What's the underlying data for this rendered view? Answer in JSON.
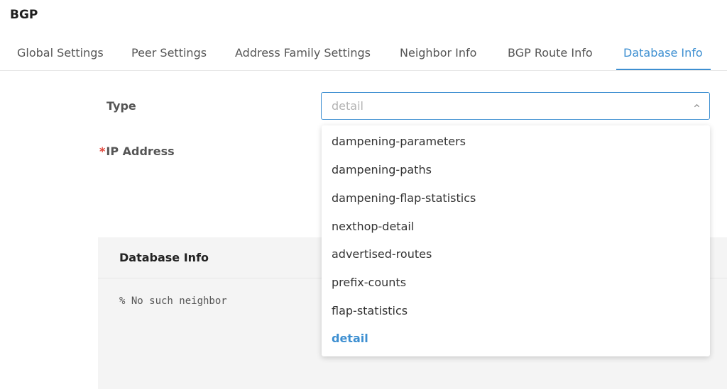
{
  "page": {
    "title": "BGP"
  },
  "tabs": [
    {
      "label": "Global Settings"
    },
    {
      "label": "Peer Settings"
    },
    {
      "label": "Address Family Settings"
    },
    {
      "label": "Neighbor Info"
    },
    {
      "label": "BGP Route Info"
    },
    {
      "label": "Database Info",
      "active": true
    }
  ],
  "form": {
    "type_label": "Type",
    "type_value": "detail",
    "ip_required_mark": "*",
    "ip_label": "IP Address"
  },
  "dropdown": {
    "options": [
      {
        "label": "dampening-parameters"
      },
      {
        "label": "dampening-paths"
      },
      {
        "label": "dampening-flap-statistics"
      },
      {
        "label": "nexthop-detail"
      },
      {
        "label": "advertised-routes"
      },
      {
        "label": "prefix-counts"
      },
      {
        "label": "flap-statistics"
      },
      {
        "label": "detail",
        "selected": true
      }
    ]
  },
  "panel": {
    "title": "Database Info",
    "output": "% No such neighbor"
  },
  "colors": {
    "accent": "#3d8fd1",
    "required": "#e0453a",
    "panel_bg": "#f4f4f4"
  },
  "icons": {
    "select_toggle": "chevron-up-icon"
  }
}
